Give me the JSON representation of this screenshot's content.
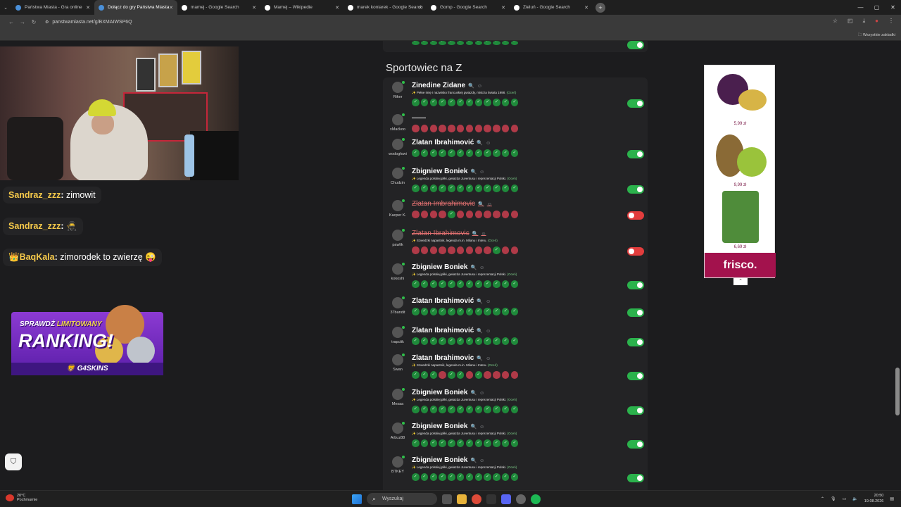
{
  "browser": {
    "tabs": [
      {
        "label": "Państwa Miasta - Gra online",
        "color": "#4a90d9",
        "active": false
      },
      {
        "label": "Dołącz do gry Państwa Miasta",
        "color": "#4a90d9",
        "active": true
      },
      {
        "label": "mamej - Google Search",
        "color": "#ffffff",
        "active": false
      },
      {
        "label": "Mamej – Wikipedie",
        "color": "#ffffff",
        "active": false
      },
      {
        "label": "marek koniarek - Google Search",
        "color": "#ffffff",
        "active": false
      },
      {
        "label": "Gomp - Google Search",
        "color": "#ffffff",
        "active": false
      },
      {
        "label": "Zieluń - Google Search",
        "color": "#ffffff",
        "active": false
      }
    ],
    "url": "panstwamiasta.net/g/BXMAIWSP6Q",
    "bookmarks_label": "Wszystkie zakładki"
  },
  "chat": [
    {
      "user": "Sandraz_zzz",
      "message": "zimowit"
    },
    {
      "user": "Sandraz_zzz",
      "message": "🥷"
    },
    {
      "user": "BaqKala",
      "message": "zimorodek to zwierzę 😜",
      "badge": "👑"
    }
  ],
  "promo": {
    "line1a": "SPRAWDŹ",
    "line1b": "LIMITOWANY",
    "line2": "RANKING!",
    "brand": "G4SKINS"
  },
  "game": {
    "section_title": "Sportowiec na Z",
    "rows": [
      {
        "user": "Riker",
        "answer": "Zinedine Zidane",
        "desc": "Pełne imię i nazwisko francuskiej gwiazdy, mistrza świata 1998.",
        "more": "(Oceń)",
        "votes": "gggggggggggg",
        "toggle": "on",
        "struck": false
      },
      {
        "user": "xMaćkoo",
        "answer": "——",
        "desc": "",
        "more": "",
        "votes": "rrrrrrrrrrrr",
        "toggle": "none",
        "struck": false
      },
      {
        "user": "wodogłowi",
        "answer": "Zlatan Ibrahimović",
        "desc": "",
        "more": "",
        "votes": "gggggggggggg",
        "toggle": "on",
        "struck": false
      },
      {
        "user": "Chudzin",
        "answer": "Zbigniew Boniek",
        "desc": "Legenda polskiej piłki, gwiazda Juventusu i reprezentacji Polski.",
        "more": "(Oceń)",
        "votes": "gggggggggggg",
        "toggle": "on",
        "struck": false
      },
      {
        "user": "Kacper K.",
        "answer": "Zlatan Imbrahimovic",
        "desc": "",
        "more": "",
        "votes": "rrrrgrrrrrrr",
        "toggle": "off",
        "struck": true
      },
      {
        "user": "pawlik",
        "answer": "Zlatan Ibrahimovic",
        "desc": "Szwedzki napastnik, legenda m.in. Milanu i Interu.",
        "more": "(Oceń)",
        "votes": "rrrrrrrrrgrr",
        "toggle": "off",
        "struck": true
      },
      {
        "user": "kokoshi",
        "answer": "Zbigniew Boniek",
        "desc": "Legenda polskiej piłki, gwiazda Juventusu i reprezentacji Polski.",
        "more": "(Oceń)",
        "votes": "gggggggggggg",
        "toggle": "on",
        "struck": false
      },
      {
        "user": "37bandit",
        "answer": "Zlatan Ibrahimović",
        "desc": "",
        "more": "",
        "votes": "gggggggggggg",
        "toggle": "on",
        "struck": false
      },
      {
        "user": "trapulik",
        "answer": "Zlatan Ibrahimović",
        "desc": "",
        "more": "",
        "votes": "gggggggggggg",
        "toggle": "on",
        "struck": false
      },
      {
        "user": "Swan",
        "answer": "Zlatan Ibrahimovic",
        "desc": "Szwedzki napastnik, legenda m.in. Milanu i Interu.",
        "more": "(Oceń)",
        "votes": "gggrggrgrrrr",
        "toggle": "on",
        "struck": false
      },
      {
        "user": "Mesaa",
        "answer": "Zbigniew Boniek",
        "desc": "Legenda polskiej piłki, gwiazda Juventusu i reprezentacji Polski.",
        "more": "(Oceń)",
        "votes": "gggggggggggg",
        "toggle": "on",
        "struck": false
      },
      {
        "user": "Arbuz88",
        "answer": "Zbigniew Boniek",
        "desc": "Legenda polskiej piłki, gwiazda Juventusu i reprezentacji Polski.",
        "more": "(Oceń)",
        "votes": "gggggggggggg",
        "toggle": "on",
        "struck": false
      },
      {
        "user": "BTKEY",
        "answer": "Zbigniew Boniek",
        "desc": "Legenda polskiej piłki, gwiazda Juventusu i reprezentacji Polski.",
        "more": "(Oceń)",
        "votes": "gggggggggggg",
        "toggle": "on",
        "struck": false
      }
    ]
  },
  "ad": {
    "prices": [
      "5,99 zł",
      "9,99 zł",
      "6,69 zł"
    ],
    "brand": "frisco."
  },
  "taskbar": {
    "temp": "20°C",
    "weather": "Pochmurnie",
    "search": "Wyszukaj",
    "time": "20:50",
    "date": "19.08.2026"
  },
  "colors": {
    "vote_green": "#1f8a3b",
    "vote_red": "#b03a48",
    "toggle_on": "#2bb24c",
    "toggle_off": "#e23d3d",
    "frisco": "#a3124d"
  }
}
